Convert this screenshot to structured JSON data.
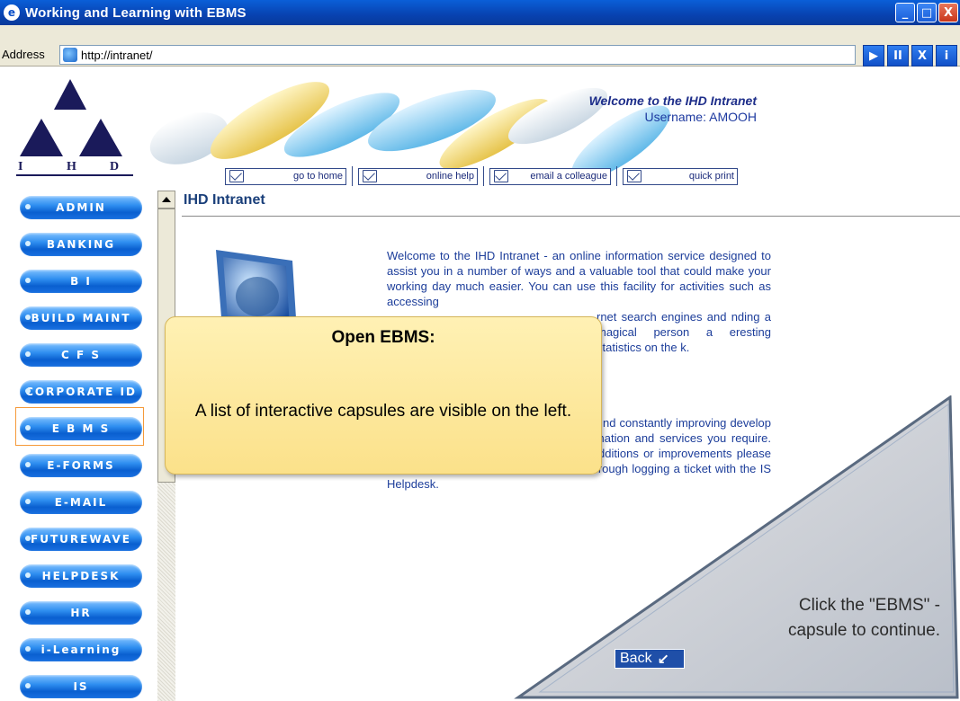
{
  "window": {
    "title": "Working and Learning with EBMS",
    "minimize": "_",
    "maximize": "□",
    "close": "X"
  },
  "address_bar": {
    "label": "Address",
    "url": "http://intranet/"
  },
  "player_controls": {
    "play": "▶",
    "pause": "II",
    "close": "X",
    "info": "i"
  },
  "header": {
    "logo_letters": [
      "I",
      "H",
      "D"
    ],
    "welcome": "Welcome to the IHD Intranet",
    "username": "Username: AMOOH",
    "nav": [
      {
        "label": "go to home"
      },
      {
        "label": "online help"
      },
      {
        "label": "email a colleague"
      },
      {
        "label": "quick print"
      }
    ]
  },
  "sidebar": {
    "capsules": [
      "ADMIN",
      "BANKING",
      "B I",
      "BUILD MAINT",
      "C F S",
      "CORPORATE ID",
      "E B M S",
      "E-FORMS",
      "E-MAIL",
      "FUTUREWAVE",
      "HELPDESK",
      "HR",
      "i-Learning",
      "IS"
    ]
  },
  "main": {
    "title": "IHD Intranet",
    "paragraph1": "Welcome to the IHD Intranet - an online information service designed to assist you in a number of ways and a valuable tool that could make your working day much easier. You can use this facility for activities such as accessing",
    "paragraph1_cont": "rnet search engines and nding a magical person a eresting statistics on the k.",
    "paragraph2": "nd constantly improving develop to serve user f all users is needed to mation and services you require. Therefore, if you have any suggested additions or improvements please do not hesitate to communicate these through logging a ticket with the IS Helpdesk."
  },
  "callout": {
    "heading": "Open EBMS:",
    "body": "A list of interactive capsules are visible on the left."
  },
  "instruction": {
    "line1": "Click the \"EBMS\" -",
    "line2": "capsule to continue.",
    "back_label": "Back"
  }
}
